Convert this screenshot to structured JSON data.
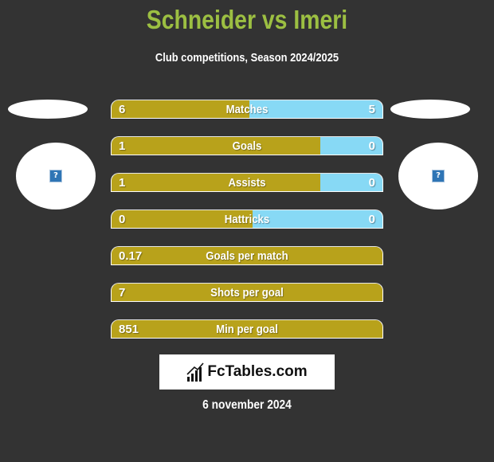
{
  "header": {
    "title": "Schneider vs Imeri",
    "subtitle": "Club competitions, Season 2024/2025"
  },
  "colors": {
    "left_bar": "#b8a21b",
    "right_bar": "#87d9f5",
    "title": "#9cbf42",
    "background": "#333333"
  },
  "players": {
    "left": {
      "avatar_icon": "missing-image-icon"
    },
    "right": {
      "avatar_icon": "missing-image-icon"
    }
  },
  "stats": [
    {
      "label": "Matches",
      "left": "6",
      "right": "5",
      "left_share": 0.51
    },
    {
      "label": "Goals",
      "left": "1",
      "right": "0",
      "left_share": 0.77
    },
    {
      "label": "Assists",
      "left": "1",
      "right": "0",
      "left_share": 0.77
    },
    {
      "label": "Hattricks",
      "left": "0",
      "right": "0",
      "left_share": 0.52
    },
    {
      "label": "Goals per match",
      "left": "0.17",
      "right": "",
      "left_share": 1.0
    },
    {
      "label": "Shots per goal",
      "left": "7",
      "right": "",
      "left_share": 1.0
    },
    {
      "label": "Min per goal",
      "left": "851",
      "right": "",
      "left_share": 1.0
    }
  ],
  "footer": {
    "logo_text": "FcTables.com",
    "logo_icon": "bar-chart-icon",
    "date": "6 november 2024"
  }
}
